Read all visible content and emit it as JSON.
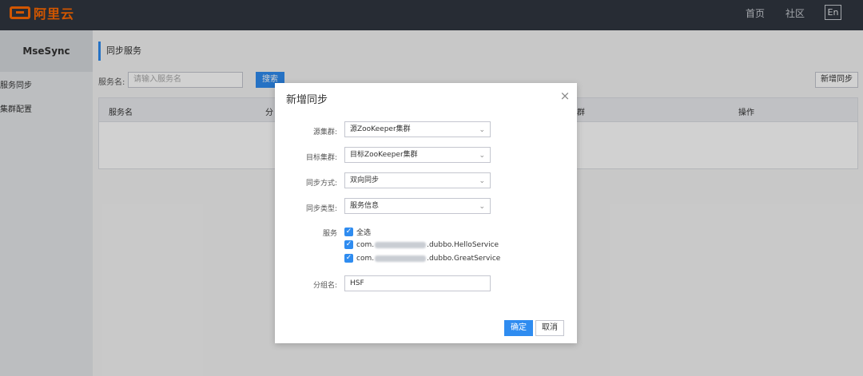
{
  "header": {
    "logo_text": "阿里云",
    "nav": [
      "首页",
      "社区"
    ],
    "lang": "En"
  },
  "sidebar": {
    "app_name": "MseSync",
    "items": [
      {
        "label": "服务同步"
      },
      {
        "label": "集群配置"
      }
    ]
  },
  "main": {
    "title": "同步服务",
    "search_label": "服务名:",
    "search_placeholder": "请输入服务名",
    "search_button": "搜索",
    "add_button": "新增同步",
    "table_headers": [
      "服务名",
      "分",
      "群",
      "操作"
    ]
  },
  "dialog": {
    "title": "新增同步",
    "fields": [
      {
        "label": "源集群:",
        "value": "源ZooKeeper集群"
      },
      {
        "label": "目标集群:",
        "value": "目标ZooKeeper集群"
      },
      {
        "label": "同步方式:",
        "value": "双向同步"
      },
      {
        "label": "同步类型:",
        "value": "服务信息"
      }
    ],
    "services_label": "服务",
    "select_all": "全选",
    "services": [
      {
        "prefix": "com.",
        "suffix": ".dubbo.HelloService"
      },
      {
        "prefix": "com.",
        "suffix": ".dubbo.GreatService"
      }
    ],
    "group_label": "分组名:",
    "group_value": "HSF",
    "ok_button": "确定",
    "cancel_button": "取消"
  },
  "colors": {
    "topbar": "#303640",
    "brand": "#ff6a00",
    "primary": "#2f8cf0"
  }
}
